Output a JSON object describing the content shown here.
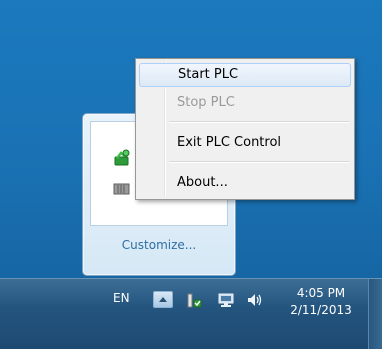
{
  "tray_overflow": {
    "customize_link": "Customize..."
  },
  "context_menu": {
    "items": [
      {
        "label": "Start PLC",
        "state": "highlighted"
      },
      {
        "label": "Stop PLC",
        "state": "disabled"
      },
      {
        "label": "Exit PLC Control",
        "state": "normal"
      },
      {
        "label": "About...",
        "state": "normal"
      }
    ]
  },
  "taskbar": {
    "language": "EN",
    "clock_time": "4:05 PM",
    "clock_date": "2/11/2013",
    "tray_icons": [
      "show-hidden-icons-icon",
      "plc-status-icon",
      "network-icon",
      "volume-icon"
    ]
  },
  "colors": {
    "desktop": "#1b79bd",
    "taskbar": "#24557f",
    "menu_bg": "#f0f0f0",
    "menu_highlight": "#dde9f6",
    "link": "#2d6ea3"
  }
}
